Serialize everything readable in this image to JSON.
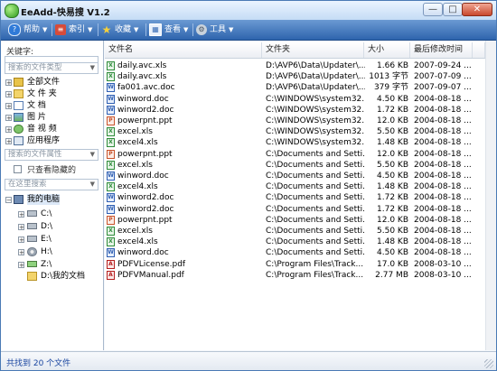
{
  "window": {
    "title": "EeAdd-快易搜 V1.2",
    "minimize": "—",
    "maximize": "□",
    "close": "✕"
  },
  "toolbar": {
    "items": [
      {
        "label": "帮助",
        "icon": "help-icon",
        "color": "#2f7ad8"
      },
      {
        "label": "索引",
        "icon": "index-icon",
        "color": "#d64b3a"
      },
      {
        "label": "收藏",
        "icon": "favorite-star-icon",
        "color": "#f2c12e"
      },
      {
        "label": "查看",
        "icon": "view-icon",
        "color": "#4a7dc9"
      },
      {
        "label": "工具",
        "icon": "tools-icon",
        "color": "#7f8c99"
      }
    ],
    "dropdown_glyph": "▼"
  },
  "sidebar": {
    "keyword_label": "关键字:",
    "keyword_value": "",
    "filetype_combo": "搜索的文件类型",
    "filetypes": [
      "全部文件",
      "文 件 夹",
      "文    档",
      "图    片",
      "音 视 频",
      "应用程序"
    ],
    "fileattr_combo": "搜索的文件属性",
    "hidden_only_label": "只查看隐藏的",
    "scope_combo": "在这里搜索",
    "tree_root": "我的电脑",
    "drives": [
      "C:\\",
      "D:\\",
      "E:\\",
      "H:\\",
      "Z:\\"
    ],
    "docs_folder": "D:\\我的文档"
  },
  "list": {
    "columns": [
      "文件名",
      "文件夹",
      "大小",
      "最后修改时间"
    ],
    "rows": [
      {
        "name": "daily.avc.xls",
        "folder": "D:\\AVP6\\Data\\Updater\\...",
        "size": "1.66 KB",
        "date": "2007-09-24 ...",
        "type": "xls"
      },
      {
        "name": "daily.avc.xls",
        "folder": "D:\\AVP6\\Data\\Updater\\...",
        "size": "1013 字节",
        "date": "2007-07-09 ...",
        "type": "xls"
      },
      {
        "name": "fa001.avc.doc",
        "folder": "D:\\AVP6\\Data\\Updater\\...",
        "size": "379 字节",
        "date": "2007-09-07 ...",
        "type": "doc"
      },
      {
        "name": "winword.doc",
        "folder": "C:\\WINDOWS\\system32...",
        "size": "4.50 KB",
        "date": "2004-08-18 ...",
        "type": "doc"
      },
      {
        "name": "winword2.doc",
        "folder": "C:\\WINDOWS\\system32...",
        "size": "1.72 KB",
        "date": "2004-08-18 ...",
        "type": "doc"
      },
      {
        "name": "powerpnt.ppt",
        "folder": "C:\\WINDOWS\\system32...",
        "size": "12.0 KB",
        "date": "2004-08-18 ...",
        "type": "ppt"
      },
      {
        "name": "excel.xls",
        "folder": "C:\\WINDOWS\\system32...",
        "size": "5.50 KB",
        "date": "2004-08-18 ...",
        "type": "xls"
      },
      {
        "name": "excel4.xls",
        "folder": "C:\\WINDOWS\\system32...",
        "size": "1.48 KB",
        "date": "2004-08-18 ...",
        "type": "xls"
      },
      {
        "name": "powerpnt.ppt",
        "folder": "C:\\Documents and Setti...",
        "size": "12.0 KB",
        "date": "2004-08-18 ...",
        "type": "ppt"
      },
      {
        "name": "excel.xls",
        "folder": "C:\\Documents and Setti...",
        "size": "5.50 KB",
        "date": "2004-08-18 ...",
        "type": "xls"
      },
      {
        "name": "winword.doc",
        "folder": "C:\\Documents and Setti...",
        "size": "4.50 KB",
        "date": "2004-08-18 ...",
        "type": "doc"
      },
      {
        "name": "excel4.xls",
        "folder": "C:\\Documents and Setti...",
        "size": "1.48 KB",
        "date": "2004-08-18 ...",
        "type": "xls"
      },
      {
        "name": "winword2.doc",
        "folder": "C:\\Documents and Setti...",
        "size": "1.72 KB",
        "date": "2004-08-18 ...",
        "type": "doc"
      },
      {
        "name": "winword2.doc",
        "folder": "C:\\Documents and Setti...",
        "size": "1.72 KB",
        "date": "2004-08-18 ...",
        "type": "doc"
      },
      {
        "name": "powerpnt.ppt",
        "folder": "C:\\Documents and Setti...",
        "size": "12.0 KB",
        "date": "2004-08-18 ...",
        "type": "ppt"
      },
      {
        "name": "excel.xls",
        "folder": "C:\\Documents and Setti...",
        "size": "5.50 KB",
        "date": "2004-08-18 ...",
        "type": "xls"
      },
      {
        "name": "excel4.xls",
        "folder": "C:\\Documents and Setti...",
        "size": "1.48 KB",
        "date": "2004-08-18 ...",
        "type": "xls"
      },
      {
        "name": "winword.doc",
        "folder": "C:\\Documents and Setti...",
        "size": "4.50 KB",
        "date": "2004-08-18 ...",
        "type": "doc"
      },
      {
        "name": "PDFVLicense.pdf",
        "folder": "C:\\Program Files\\Track...",
        "size": "17.0 KB",
        "date": "2008-03-10 ...",
        "type": "pdf"
      },
      {
        "name": "PDFVManual.pdf",
        "folder": "C:\\Program Files\\Track...",
        "size": "2.77 MB",
        "date": "2008-03-10 ...",
        "type": "pdf"
      }
    ]
  },
  "status": {
    "text": "共找到 20 个文件"
  }
}
